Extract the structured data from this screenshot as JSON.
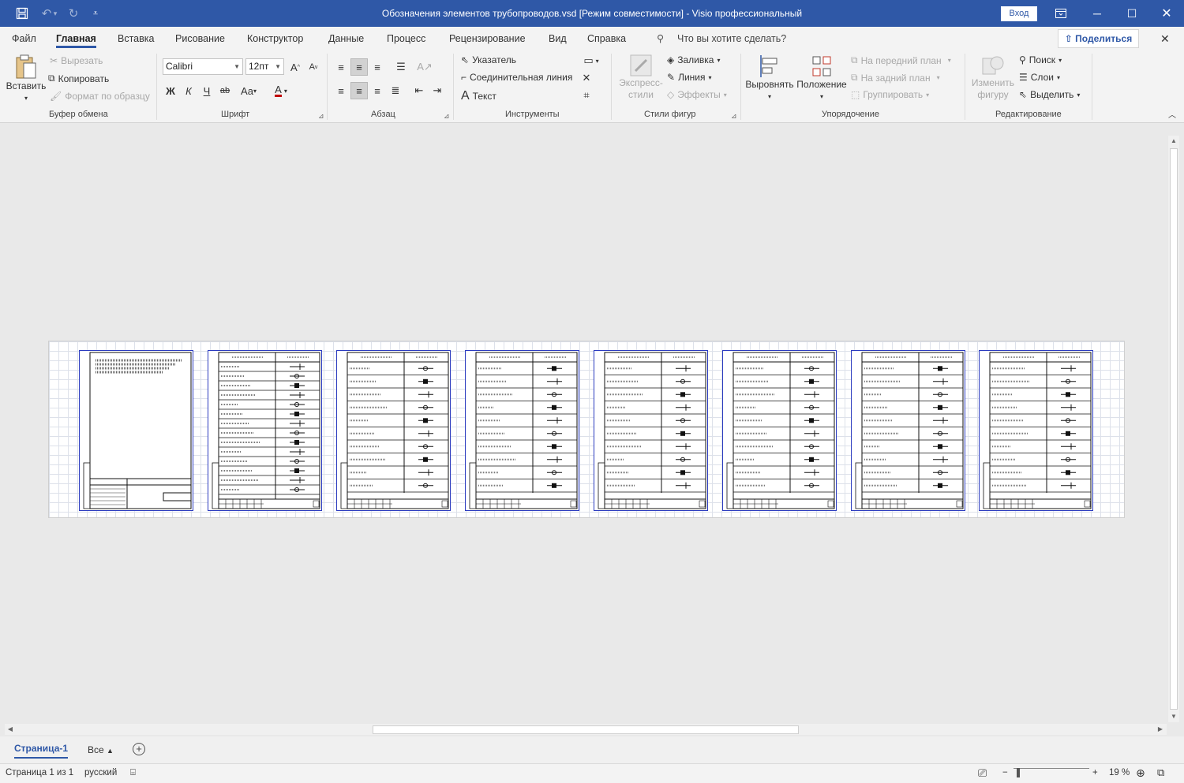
{
  "window": {
    "title": "Обозначения элементов трубопроводов.vsd  [Режим совместимости]  -  Visio профессиональный",
    "signin": "Вход"
  },
  "tabs": [
    "Файл",
    "Главная",
    "Вставка",
    "Рисование",
    "Конструктор",
    "Данные",
    "Процесс",
    "Рецензирование",
    "Вид",
    "Справка"
  ],
  "active_tab": "Главная",
  "tell_me": "Что вы хотите сделать?",
  "share": "Поделиться",
  "ribbon": {
    "clipboard": {
      "group": "Буфер обмена",
      "paste": "Вставить",
      "cut": "Вырезать",
      "copy": "Копировать",
      "format_painter": "Формат по образцу"
    },
    "font": {
      "group": "Шрифт",
      "name": "Calibri",
      "size": "12пт",
      "bold": "Ж",
      "italic": "К",
      "underline": "Ч",
      "strike": "ab",
      "case": "Aa",
      "color": "A"
    },
    "paragraph": {
      "group": "Абзац"
    },
    "tools": {
      "group": "Инструменты",
      "pointer": "Указатель",
      "connector": "Соединительная линия",
      "text": "Текст"
    },
    "shape_styles": {
      "group": "Стили фигур",
      "quick_styles_1": "Экспресс-",
      "quick_styles_2": "стили",
      "fill": "Заливка",
      "line": "Линия",
      "effects": "Эффекты"
    },
    "arrange": {
      "group": "Упорядочение",
      "align": "Выровнять",
      "position": "Положение",
      "bring_front": "На передний план",
      "send_back": "На задний план",
      "group_btn": "Группировать"
    },
    "editing": {
      "group": "Редактирование",
      "change_shape_1": "Изменить",
      "change_shape_2": "фигуру",
      "find": "Поиск",
      "layers": "Слои",
      "select": "Выделить"
    }
  },
  "pages": {
    "current": "Страница-1",
    "all": "Все"
  },
  "status": {
    "page": "Страница 1 из 1",
    "language": "русский",
    "zoom": "19 %"
  }
}
